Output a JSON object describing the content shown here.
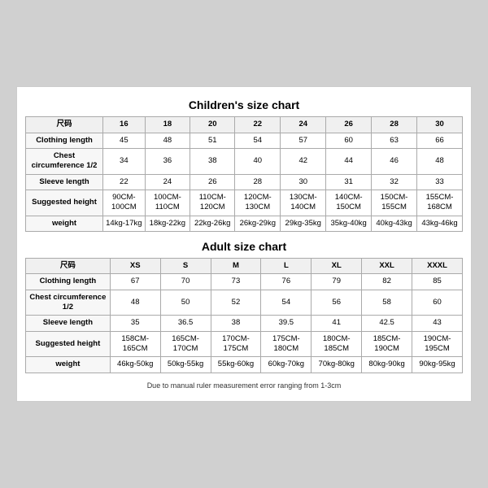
{
  "children": {
    "title": "Children's size chart",
    "columns": [
      "尺码",
      "16",
      "18",
      "20",
      "22",
      "24",
      "26",
      "28",
      "30"
    ],
    "rows": [
      {
        "label": "Clothing length",
        "values": [
          "45",
          "48",
          "51",
          "54",
          "57",
          "60",
          "63",
          "66"
        ]
      },
      {
        "label": "Chest circumference 1/2",
        "values": [
          "34",
          "36",
          "38",
          "40",
          "42",
          "44",
          "46",
          "48"
        ]
      },
      {
        "label": "Sleeve length",
        "values": [
          "22",
          "24",
          "26",
          "28",
          "30",
          "31",
          "32",
          "33"
        ]
      },
      {
        "label": "Suggested height",
        "values": [
          "90CM-100CM",
          "100CM-110CM",
          "110CM-120CM",
          "120CM-130CM",
          "130CM-140CM",
          "140CM-150CM",
          "150CM-155CM",
          "155CM-168CM"
        ]
      },
      {
        "label": "weight",
        "values": [
          "14kg-17kg",
          "18kg-22kg",
          "22kg-26kg",
          "26kg-29kg",
          "29kg-35kg",
          "35kg-40kg",
          "40kg-43kg",
          "43kg-46kg"
        ]
      }
    ]
  },
  "adult": {
    "title": "Adult size chart",
    "columns": [
      "尺码",
      "XS",
      "S",
      "M",
      "L",
      "XL",
      "XXL",
      "XXXL"
    ],
    "rows": [
      {
        "label": "Clothing length",
        "values": [
          "67",
          "70",
          "73",
          "76",
          "79",
          "82",
          "85"
        ]
      },
      {
        "label": "Chest circumference 1/2",
        "values": [
          "48",
          "50",
          "52",
          "54",
          "56",
          "58",
          "60"
        ]
      },
      {
        "label": "Sleeve length",
        "values": [
          "35",
          "36.5",
          "38",
          "39.5",
          "41",
          "42.5",
          "43"
        ]
      },
      {
        "label": "Suggested height",
        "values": [
          "158CM-165CM",
          "165CM-170CM",
          "170CM-175CM",
          "175CM-180CM",
          "180CM-185CM",
          "185CM-190CM",
          "190CM-195CM"
        ]
      },
      {
        "label": "weight",
        "values": [
          "46kg-50kg",
          "50kg-55kg",
          "55kg-60kg",
          "60kg-70kg",
          "70kg-80kg",
          "80kg-90kg",
          "90kg-95kg"
        ]
      }
    ]
  },
  "note": "Due to manual ruler measurement error ranging from 1-3cm"
}
